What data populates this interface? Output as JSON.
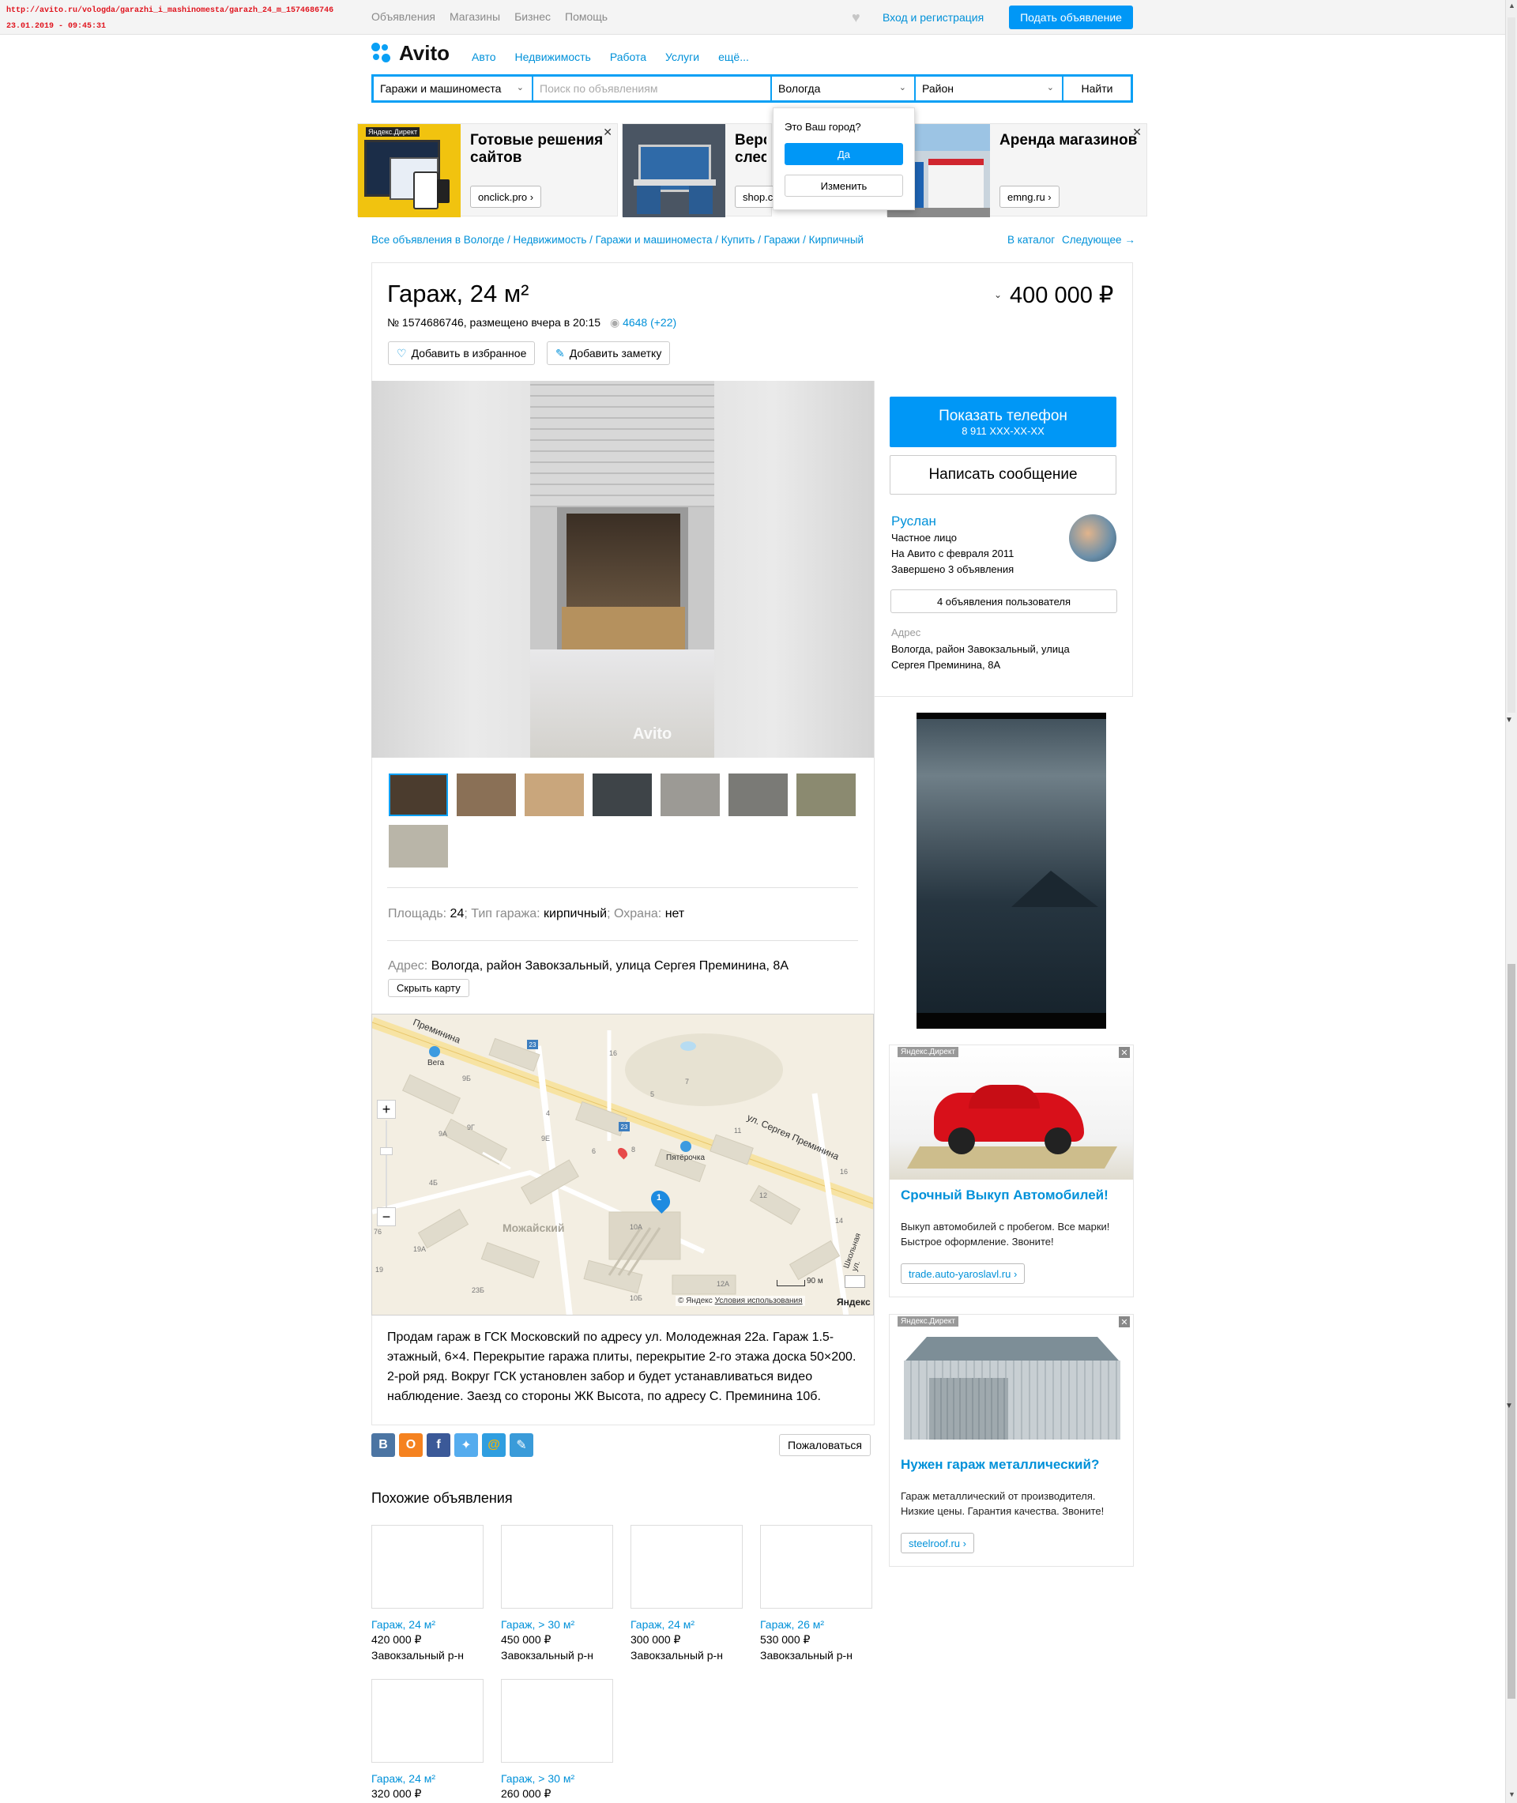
{
  "stamp": {
    "url": "http://avito.ru/vologda/garazhi_i_mashinomesta/garazh_24_m_1574686746",
    "datetime": "23.01.2019 - 09:45:31"
  },
  "topbar": {
    "links": [
      "Объявления",
      "Магазины",
      "Бизнес",
      "Помощь"
    ],
    "login": "Вход и регистрация",
    "post_ad": "Подать объявление"
  },
  "header": {
    "logo": "Avito",
    "nav": [
      "Авто",
      "Недвижимость",
      "Работа",
      "Услуги",
      "ещё..."
    ]
  },
  "search": {
    "category": "Гаражи и машиноместа",
    "placeholder": "Поиск по объявлениям",
    "city": "Вологда",
    "district": "Район",
    "submit": "Найти"
  },
  "city_popup": {
    "question": "Это Ваш город?",
    "yes": "Да",
    "change": "Изменить"
  },
  "ads_top": [
    {
      "label": "Яндекс.Директ",
      "title": "Готовые решения сайтов",
      "domain": "onclick.pro ›"
    },
    {
      "title": "Верст слеса",
      "domain": "shop.c"
    },
    {
      "title": "Аренда магазинов",
      "domain": "emng.ru ›"
    }
  ],
  "breadcrumbs": {
    "trail": "Все объявления в Вологде / Недвижимость / Гаражи и машиноместа / Купить / Гаражи / Кирпичный",
    "catalog": "В каталог",
    "next": "Следующее →"
  },
  "listing": {
    "title": "Гараж, 24 м²",
    "price": "400 000 ₽",
    "meta": "№ 1574686746, размещено вчера в 20:15",
    "views": "4648 (+22)",
    "favorite": "Добавить в избранное",
    "note": "Добавить заметку",
    "watermark": "Avito"
  },
  "seller": {
    "show_phone": "Показать телефон",
    "phone_mask": "8 911 XXX-XX-XX",
    "message": "Написать сообщение",
    "name": "Руслан",
    "type": "Частное лицо",
    "since": "На Авито с февраля 2011",
    "completed": "Завершено 3 объявления",
    "listings_btn": "4 объявления пользователя",
    "address_label": "Адрес",
    "address": "Вологда, район Завокзальный, улица Сергея Преминина, 8А"
  },
  "params": {
    "area_k": "Площадь:",
    "area_v": "24",
    "type_k": "Тип гаража:",
    "type_v": "кирпичный",
    "guard_k": "Охрана:",
    "guard_v": "нет"
  },
  "address_block": {
    "label": "Адрес:",
    "value": "Вологда, район Завокзальный, улица Сергея Преминина, 8А",
    "hide_map": "Скрыть карту"
  },
  "map": {
    "street1": "ул. Сергея Преминина",
    "street2": "Преминина",
    "street3": "Школьная ул.",
    "district": "Можайский",
    "poi1": "Вега",
    "poi2": "Пятёрочка",
    "scale": "90 м",
    "copyright": "© Яндекс",
    "terms": "Условия использования",
    "brand": "Яндекс",
    "marker": "1",
    "bus": "23",
    "houses": [
      "16",
      "9Б",
      "4",
      "9Г",
      "9А",
      "9Е",
      "6",
      "5",
      "7",
      "8",
      "11",
      "4Б",
      "12",
      "16",
      "14",
      "10А",
      "19А",
      "19",
      "76",
      "23Б",
      "10Б",
      "12А"
    ]
  },
  "description": "Продам гараж в ГСК Московский по адресу ул. Молодежная 22а. Гараж 1.5-этажный, 6×4. Перекрытие гаража плиты, перекрытие 2-го этажа доска 50×200. 2-рой ряд. Вокруг ГСК установлен забор и будет устанавливаться видео наблюдение. Заезд со стороны ЖК Высота, по адресу С. Преминина 10б.",
  "share": {
    "icons": [
      "vk-icon",
      "ok-icon",
      "facebook-icon",
      "twitter-icon",
      "mail-icon",
      "livejournal-icon"
    ],
    "vk": "B",
    "ok": "О",
    "fb": "f",
    "mail": "@",
    "complain": "Пожаловаться"
  },
  "similar": {
    "title": "Похожие объявления",
    "items": [
      {
        "title": "Гараж, 24 м²",
        "price": "420 000 ₽",
        "region": "Завокзальный р-н"
      },
      {
        "title": "Гараж, > 30 м²",
        "price": "450 000 ₽",
        "region": "Завокзальный р-н"
      },
      {
        "title": "Гараж, 24 м²",
        "price": "300 000 ₽",
        "region": "Завокзальный р-н"
      },
      {
        "title": "Гараж, 26 м²",
        "price": "530 000 ₽",
        "region": "Завокзальный р-н"
      },
      {
        "title": "Гараж, 24 м²",
        "price": "320 000 ₽",
        "region": ""
      },
      {
        "title": "Гараж, > 30 м²",
        "price": "260 000 ₽",
        "region": ""
      }
    ]
  },
  "ads_right": [
    {
      "label": "Яндекс.Директ",
      "title": "Срочный Выкуп Автомобилей!",
      "text": "Выкуп автомобилей с пробегом. Все марки! Быстрое оформление. Звоните!",
      "domain": "trade.auto-yaroslavl.ru ›"
    },
    {
      "label": "Яндекс.Директ",
      "title": "Нужен гараж металлический?",
      "text": "Гараж металлический от производителя. Низкие цены. Гарантия качества. Звоните!",
      "domain": "steelroof.ru ›"
    }
  ],
  "colors": {
    "accent": "#0097f6",
    "link": "#0091d9",
    "stamp": "#e0141e"
  }
}
